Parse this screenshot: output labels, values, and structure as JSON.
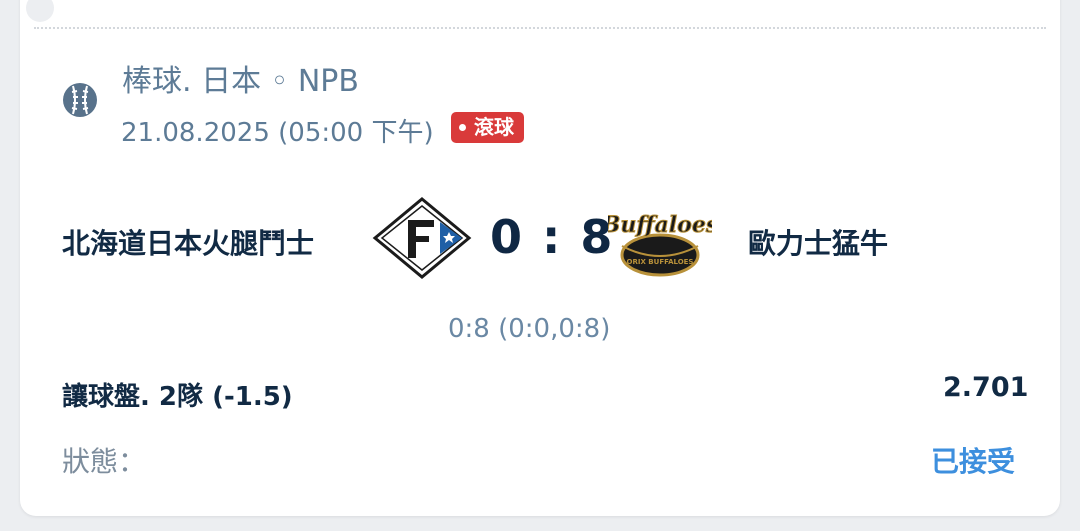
{
  "colors": {
    "primary_text": "#112a44",
    "muted_text": "#5d7b96",
    "live_badge": "#d93a3a",
    "accepted": "#3d8fde"
  },
  "bet": {
    "sport_icon": "baseball-icon",
    "league": "棒球. 日本 ◦ NPB",
    "datetime": "21.08.2025 (05:00 下午)",
    "live_label": "滾球",
    "home_team": "北海道日本火腿鬥士",
    "home_logo": "fighters-logo",
    "away_team": "歐力士猛牛",
    "away_logo": "buffaloes-logo",
    "away_logo_text": "Buffaloes",
    "away_logo_subtext": "ORIX BUFFALOES",
    "score": "0 : 8",
    "score_detail": "0:8 (0:0,0:8)",
    "market": "讓球盤. 2隊 (-1.5)",
    "odds": "2.701",
    "status_label": "狀態：",
    "status_value": "已接受"
  }
}
